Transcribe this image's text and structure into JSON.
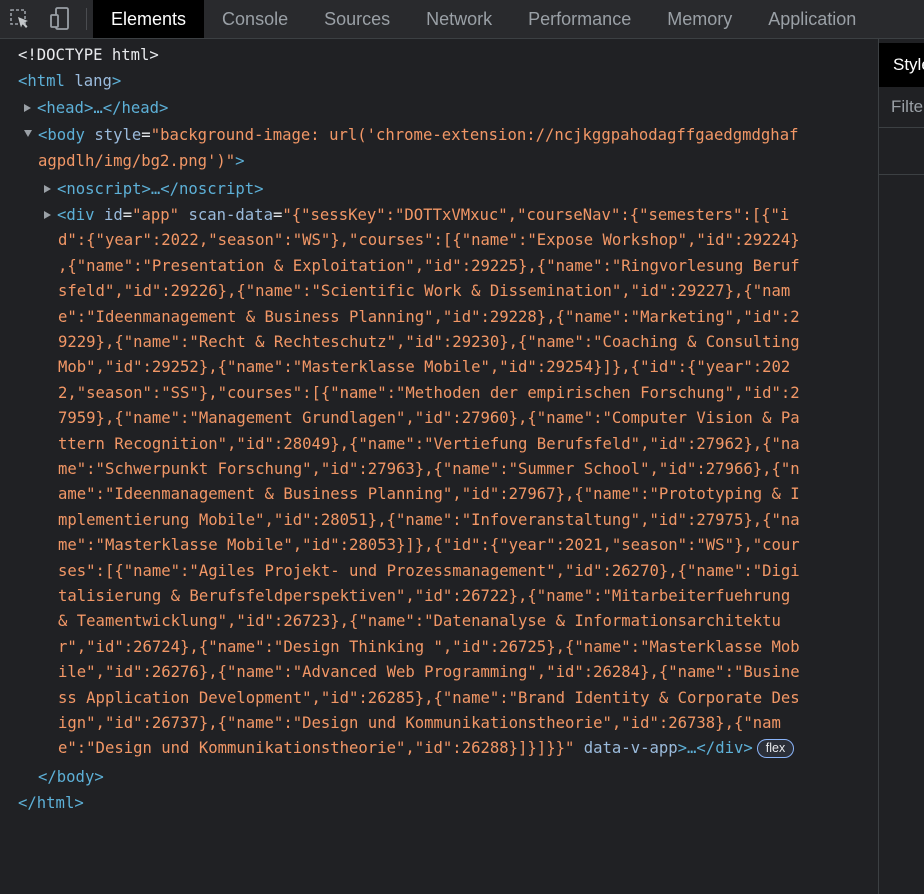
{
  "toolbar": {
    "icons": [
      "inspect-icon",
      "device-toggle-icon"
    ],
    "tabs": [
      {
        "label": "Elements",
        "active": true
      },
      {
        "label": "Console"
      },
      {
        "label": "Sources"
      },
      {
        "label": "Network"
      },
      {
        "label": "Performance"
      },
      {
        "label": "Memory"
      },
      {
        "label": "Application"
      }
    ]
  },
  "styles_pane": {
    "tab_label": "Styles",
    "filter_placeholder": "Filter"
  },
  "dom_tree": {
    "doctype": "<!DOCTYPE html>",
    "html_open_tag": "<html",
    "html_open_attr": " lang",
    "html_open_close": ">",
    "head_line": "<head>…</head>",
    "body_open": "<body",
    "body_attr_name": " style",
    "body_style_1": "\"background-image: url('chrome-extension://ncjkggpahodagffgaedgmdghaf",
    "body_style_2": "agpdlh/img/bg2.png')\"",
    "body_open_close": ">",
    "noscript_line": "<noscript>…</noscript>",
    "div_open": "<div",
    "div_id_attr": " id",
    "div_id_val": "\"app\"",
    "div_scan_attr": " scan-data",
    "scan_data_lines": [
      "\"{\"sessKey\":\"DOTTxVMxuc\",\"courseNav\":{\"semesters\":[{\"i",
      "d\":{\"year\":2022,\"season\":\"WS\"},\"courses\":[{\"name\":\"Expose Workshop\",\"id\":29224}",
      ",{\"name\":\"Presentation & Exploitation\",\"id\":29225},{\"name\":\"Ringvorlesung Beruf",
      "sfeld\",\"id\":29226},{\"name\":\"Scientific Work & Dissemination\",\"id\":29227},{\"nam",
      "e\":\"Ideenmanagement & Business Planning\",\"id\":29228},{\"name\":\"Marketing\",\"id\":2",
      "9229},{\"name\":\"Recht & Rechteschutz\",\"id\":29230},{\"name\":\"Coaching & Consulting",
      "Mob\",\"id\":29252},{\"name\":\"Masterklasse Mobile\",\"id\":29254}]},{\"id\":{\"year\":202",
      "2,\"season\":\"SS\"},\"courses\":[{\"name\":\"Methoden der empirischen Forschung\",\"id\":2",
      "7959},{\"name\":\"Management Grundlagen\",\"id\":27960},{\"name\":\"Computer Vision & Pa",
      "ttern Recognition\",\"id\":28049},{\"name\":\"Vertiefung Berufsfeld\",\"id\":27962},{\"na",
      "me\":\"Schwerpunkt Forschung\",\"id\":27963},{\"name\":\"Summer School\",\"id\":27966},{\"n",
      "ame\":\"Ideenmanagement & Business Planning\",\"id\":27967},{\"name\":\"Prototyping & I",
      "mplementierung Mobile\",\"id\":28051},{\"name\":\"Infoveranstaltung\",\"id\":27975},{\"na",
      "me\":\"Masterklasse Mobile\",\"id\":28053}]},{\"id\":{\"year\":2021,\"season\":\"WS\"},\"cour",
      "ses\":[{\"name\":\"Agiles Projekt- und Prozessmanagement\",\"id\":26270},{\"name\":\"Digi",
      "talisierung & Berufsfeldperspektiven\",\"id\":26722},{\"name\":\"Mitarbeiterfuehrung",
      "& Teamentwicklung\",\"id\":26723},{\"name\":\"Datenanalyse & Informationsarchitektu",
      "r\",\"id\":26724},{\"name\":\"Design Thinking \",\"id\":26725},{\"name\":\"Masterklasse Mob",
      "ile\",\"id\":26276},{\"name\":\"Advanced Web Programming\",\"id\":26284},{\"name\":\"Busine",
      "ss Application Development\",\"id\":26285},{\"name\":\"Brand Identity & Corporate Des",
      "ign\",\"id\":26737},{\"name\":\"Design und Kommunikationstheorie\",\"id\":26738},{\"nam",
      "e\":\"Design und Kommunikationstheorie\",\"id\":26288}]}]}}\""
    ],
    "div_vapp_attr": " data-v-app",
    "div_close": ">…</div>",
    "flex_badge": "flex",
    "body_close": "</body>",
    "html_close": "</html>"
  },
  "colors": {
    "background": "#202124",
    "toolbar": "#292a2d",
    "tag": "#5db0d7",
    "attr_name": "#9bbbdc",
    "attr_value": "#f29766"
  }
}
